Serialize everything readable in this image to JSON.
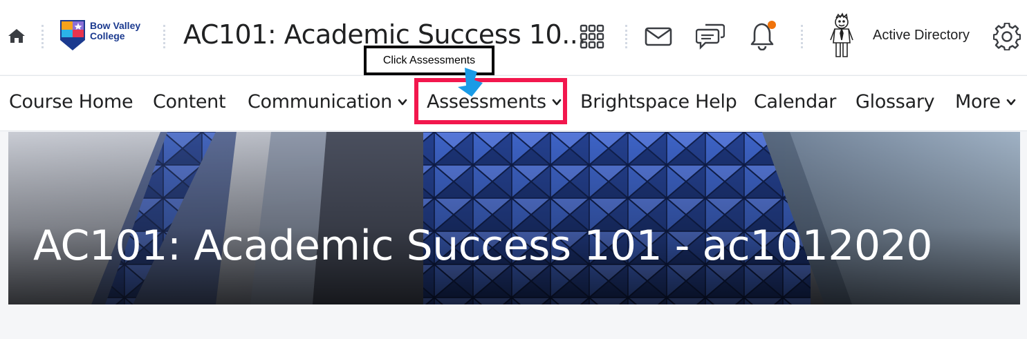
{
  "header": {
    "logo_text_line1": "Bow Valley",
    "logo_text_line2": "College",
    "course_title": "AC101: Academic Success 10...",
    "user_name": "Active Directory",
    "icons": [
      "home-icon",
      "waffle-grid-icon",
      "mail-icon",
      "chat-icon",
      "bell-icon",
      "avatar",
      "gear-icon"
    ],
    "notification_color": "#f0730b"
  },
  "nav": {
    "items": [
      {
        "label": "Course Home",
        "dropdown": false
      },
      {
        "label": "Content",
        "dropdown": false
      },
      {
        "label": "Communication",
        "dropdown": true
      },
      {
        "label": "Assessments",
        "dropdown": true
      },
      {
        "label": "Brightspace Help",
        "dropdown": false
      },
      {
        "label": "Calendar",
        "dropdown": false
      },
      {
        "label": "Glossary",
        "dropdown": false
      },
      {
        "label": "More",
        "dropdown": true
      }
    ]
  },
  "tutorial": {
    "callout_text": "Click Assessments",
    "highlight_color": "#f2174d",
    "arrow_color": "#1a9be6"
  },
  "banner": {
    "title": "AC101: Academic Success 101 - ac1012020"
  }
}
